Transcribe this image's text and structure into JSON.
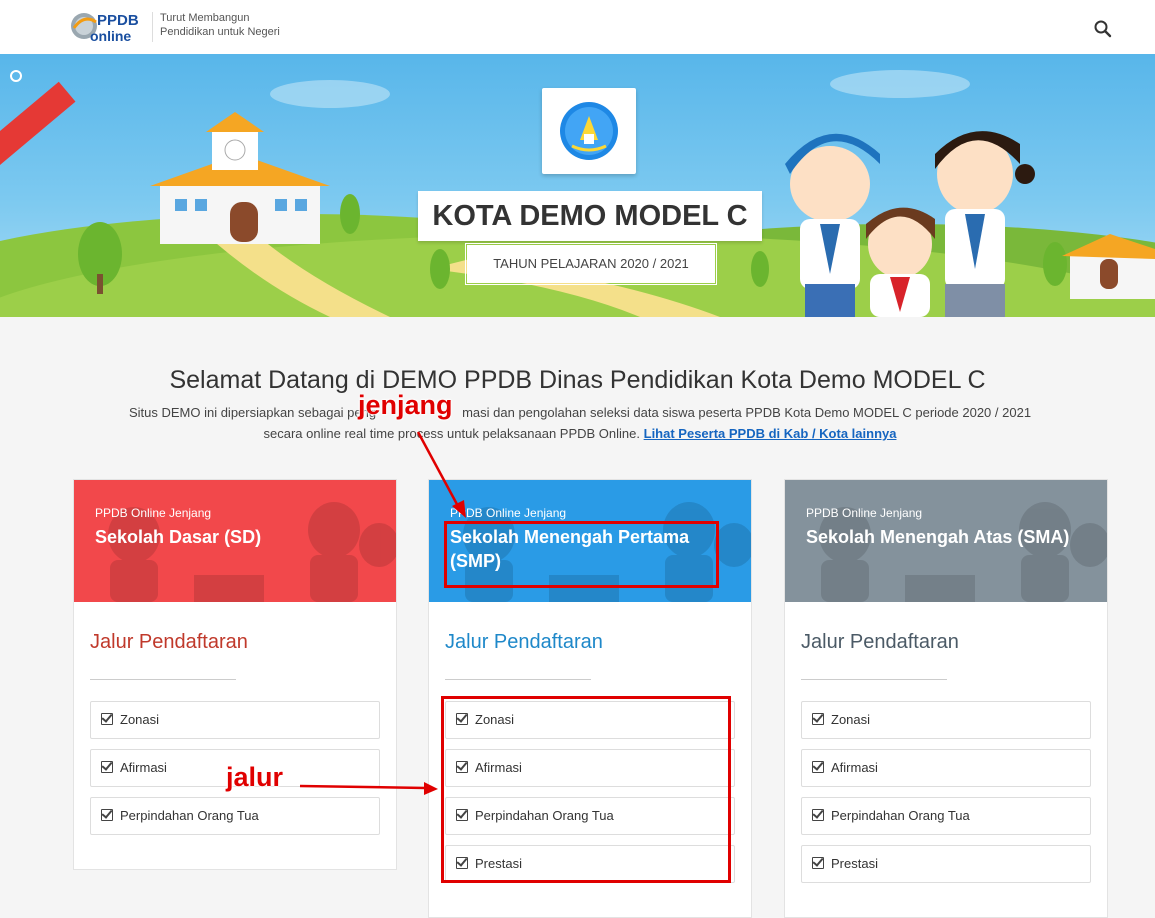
{
  "header": {
    "logo_text": "PPDB online",
    "tagline_line1": "Turut Membangun",
    "tagline_line2": "Pendidikan untuk Negeri",
    "search_icon": "search-icon"
  },
  "hero": {
    "title": "KOTA DEMO MODEL C",
    "year": "TAHUN PELAJARAN 2020 / 2021"
  },
  "welcome": {
    "title": "Selamat Datang di DEMO PPDB Dinas Pendidikan Kota Demo MODEL C",
    "text_part1": "Situs DEMO ini dipersiapkan sebagai peng",
    "text_part2": "masi dan pengolahan seleksi data siswa peserta PPDB Kota Demo MODEL C periode 2020 / 2021",
    "text_line2": "secara online real time process untuk pelaksanaan PPDB Online. ",
    "link": "Lihat Peserta PPDB di Kab / Kota lainnya"
  },
  "cards": [
    {
      "kicker": "PPDB Online Jenjang",
      "name": "Sekolah Dasar (SD)",
      "color": "#f2484b",
      "title_color": "#c0392b",
      "jalur_title": "Jalur Pendaftaran",
      "items": [
        "Zonasi",
        "Afirmasi",
        "Perpindahan Orang Tua"
      ]
    },
    {
      "kicker": "PPDB Online Jenjang",
      "name": "Sekolah Menengah Pertama (SMP)",
      "color": "#2a9be6",
      "title_color": "#1e88c9",
      "jalur_title": "Jalur Pendaftaran",
      "items": [
        "Zonasi",
        "Afirmasi",
        "Perpindahan Orang Tua",
        "Prestasi"
      ]
    },
    {
      "kicker": "PPDB Online Jenjang",
      "name": "Sekolah Menengah Atas (SMA)",
      "color": "#84929c",
      "title_color": "#4b5a66",
      "jalur_title": "Jalur Pendaftaran",
      "items": [
        "Zonasi",
        "Afirmasi",
        "Perpindahan Orang Tua",
        "Prestasi"
      ]
    }
  ],
  "annotations": {
    "jenjang": "jenjang",
    "jalur": "jalur",
    "color": "#e00000"
  }
}
